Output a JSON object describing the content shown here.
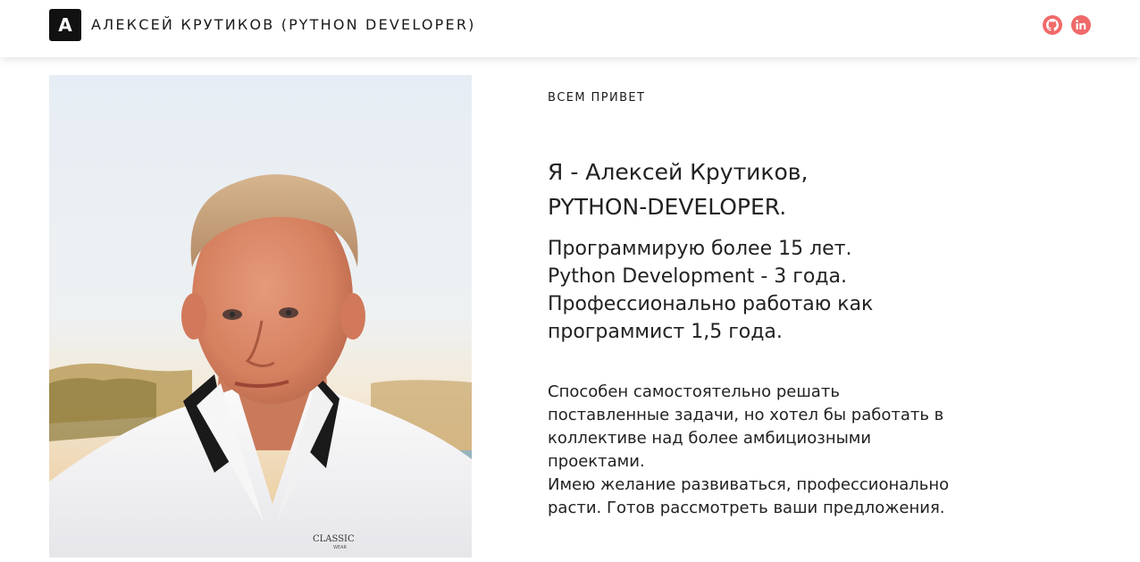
{
  "header": {
    "logo_letter": "A",
    "title": "АЛЕКСЕЙ КРУТИКОВ (PYTHON DEVELOPER)",
    "social": [
      {
        "name": "github-icon"
      },
      {
        "name": "linkedin-icon",
        "text": "in"
      }
    ]
  },
  "colors": {
    "accent": "#f06a6a",
    "logo_bg": "#111111",
    "text": "#222222"
  },
  "main": {
    "greeting": "ВСЕМ ПРИВЕТ",
    "headline": [
      "Я - Алексей Крутиков,",
      "PYTHON-DEVELOPER."
    ],
    "experience": [
      "Программирую более 15 лет.",
      "Python Development - 3 года.",
      "Профессионально работаю как",
      "программист 1,5 года."
    ],
    "about": [
      "Способен самостоятельно решать",
      "поставленные задачи, но хотел бы работать в",
      "коллективе над более амбициозными",
      "проектами.",
      "Имею желание развиваться, профессионально",
      "расти. Готов рассмотреть ваши предложения."
    ],
    "photo": {
      "shirt_text": "CLASSIC",
      "shirt_subtext": "WEAR"
    }
  }
}
